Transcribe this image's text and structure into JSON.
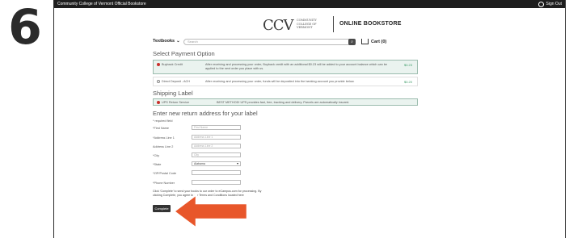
{
  "step_number": "6",
  "topbar": {
    "site_name": "Community College of Vermont Official Bookstore",
    "sign_in": "Sign Out"
  },
  "logo": {
    "mark": "CCV",
    "words": "COMMUNITY COLLEGE OF VERMONT",
    "store": "ONLINE BOOKSTORE"
  },
  "nav": {
    "textbooks": "Textbooks",
    "search_placeholder": "Search",
    "cart": "Cart (0)"
  },
  "payment": {
    "heading": "Select Payment Option",
    "options": [
      {
        "label": "Buyback Credit",
        "desc": "After receiving and processing your order, Buyback credit with an additional $0.23 will be added to your account balance which can be applied to the next order you place with us.",
        "amount": "$0.23",
        "selected": true
      },
      {
        "label": "Direct Deposit - ACH",
        "desc": "After receiving and processing your order, funds will be deposited into the banking account you provide below.",
        "amount": "$0.20",
        "selected": false
      }
    ]
  },
  "shipping": {
    "heading": "Shipping Label",
    "label": "UPS Return Service",
    "desc": "BEST METHOD! UPS provides fast, free, tracking and delivery. Parcels are automatically insured."
  },
  "address": {
    "heading": "Enter new return address for your label",
    "required_note": "* required field",
    "fields": [
      {
        "label": "*First Name",
        "placeholder": "First Name"
      },
      {
        "label": "*Address Line 1",
        "placeholder": "Address Line 1"
      },
      {
        "label": "Address Line 2",
        "placeholder": "Address Line 2"
      },
      {
        "label": "*City",
        "placeholder": "City"
      },
      {
        "label": "*State",
        "placeholder": "Alabama"
      },
      {
        "label": "*ZIP/Postal Code",
        "placeholder": ""
      },
      {
        "label": "*Phone Number",
        "placeholder": ""
      }
    ]
  },
  "note": "Click 'Complete' to send your books to our order to eCampus.com for processing. By clicking Complete, you agree to our Terms and Conditions located here",
  "complete_button": "Complete"
}
